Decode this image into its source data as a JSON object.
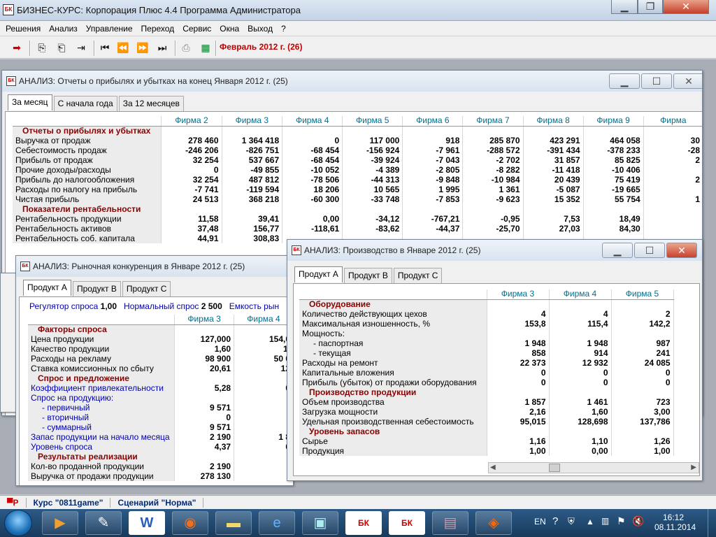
{
  "app": {
    "title": "БИЗНЕС-КУРС: Корпорация Плюс 4.4 Программа Администратора",
    "logo": "БК"
  },
  "menu": [
    "Решения",
    "Анализ",
    "Управление",
    "Переход",
    "Сервис",
    "Окна",
    "Выход",
    "?"
  ],
  "toolbar": {
    "period": "Февраль 2012 г. (26)"
  },
  "win1": {
    "title": "АНАЛИЗ: Отчеты о прибылях и убытках на конец Января 2012 г. (25)",
    "tabs": [
      "За месяц",
      "С начала года",
      "За 12 месяцев"
    ],
    "headers": [
      "Фирма 2",
      "Фирма 3",
      "Фирма 4",
      "Фирма 5",
      "Фирма 6",
      "Фирма 7",
      "Фирма 8",
      "Фирма 9",
      "Фирма"
    ],
    "rows": [
      {
        "label": "Отчеты о прибылях и убытках",
        "section": true,
        "values": [
          "",
          "",
          "",
          "",
          "",
          "",
          "",
          "",
          ""
        ]
      },
      {
        "label": "Выручка от продаж",
        "values": [
          "278 460",
          "1 364 418",
          "0",
          "117 000",
          "918",
          "285 870",
          "423 291",
          "464 058",
          "30"
        ]
      },
      {
        "label": "Себестоимость продаж",
        "values": [
          "-246 206",
          "-826 751",
          "-68 454",
          "-156 924",
          "-7 961",
          "-288 572",
          "-391 434",
          "-378 233",
          "-28"
        ]
      },
      {
        "label": "Прибыль от продаж",
        "values": [
          "32 254",
          "537 667",
          "-68 454",
          "-39 924",
          "-7 043",
          "-2 702",
          "31 857",
          "85 825",
          "2"
        ]
      },
      {
        "label": "Прочие доходы/расходы",
        "values": [
          "0",
          "-49 855",
          "-10 052",
          "-4 389",
          "-2 805",
          "-8 282",
          "-11 418",
          "-10 406",
          ""
        ]
      },
      {
        "label": "Прибыль до налогообложения",
        "values": [
          "32 254",
          "487 812",
          "-78 506",
          "-44 313",
          "-9 848",
          "-10 984",
          "20 439",
          "75 419",
          "2"
        ]
      },
      {
        "label": "Расходы по налогу на прибыль",
        "values": [
          "-7 741",
          "-119 594",
          "18 206",
          "10 565",
          "1 995",
          "1 361",
          "-5 087",
          "-19 665",
          ""
        ]
      },
      {
        "label": "Чистая прибыль",
        "values": [
          "24 513",
          "368 218",
          "-60 300",
          "-33 748",
          "-7 853",
          "-9 623",
          "15 352",
          "55 754",
          "1"
        ]
      },
      {
        "label": "Показатели рентабельности",
        "section": true,
        "values": [
          "",
          "",
          "",
          "",
          "",
          "",
          "",
          "",
          ""
        ]
      },
      {
        "label": "Рентабельность продукции",
        "values": [
          "11,58",
          "39,41",
          "0,00",
          "-34,12",
          "-767,21",
          "-0,95",
          "7,53",
          "18,49",
          ""
        ]
      },
      {
        "label": "Рентабельность активов",
        "values": [
          "37,48",
          "156,77",
          "-118,61",
          "-83,62",
          "-44,37",
          "-25,70",
          "27,03",
          "84,30",
          ""
        ]
      },
      {
        "label": "Рентабельность соб. капитала",
        "values": [
          "44,91",
          "308,83",
          "",
          "",
          "",
          "",
          "",
          "",
          ""
        ]
      }
    ]
  },
  "win2": {
    "title": "АНАЛИЗ: Рыночная конкуренция в Январе 2012 г. (25)",
    "tabs": [
      "Продукт А",
      "Продукт В",
      "Продукт С"
    ],
    "info": {
      "reg_label": "Регулятор спроса",
      "reg_value": "1,00",
      "norm_label": "Нормальный спрос",
      "norm_value": "2 500",
      "cap_label": "Емкость рын"
    },
    "headers": [
      "Фирма 3",
      "Фирма 4"
    ],
    "rows": [
      {
        "label": "Факторы спроса",
        "section": true,
        "values": [
          "",
          ""
        ]
      },
      {
        "label": "Цена продукции",
        "values": [
          "127,000",
          "154,0"
        ]
      },
      {
        "label": "Качество продукции",
        "values": [
          "1,60",
          "1,"
        ]
      },
      {
        "label": "Расходы на рекламу",
        "values": [
          "98 900",
          "50 0"
        ]
      },
      {
        "label": "Ставка комиссионных по сбыту",
        "values": [
          "20,61",
          "12"
        ]
      },
      {
        "label": "Спрос и предложение",
        "section": true,
        "values": [
          "",
          ""
        ]
      },
      {
        "label": "Коэффициент привлекательности",
        "blue": true,
        "values": [
          "5,28",
          "0"
        ]
      },
      {
        "label": "Спрос на продукцию:",
        "blue": true,
        "values": [
          "",
          ""
        ]
      },
      {
        "label": "- первичный",
        "blue": true,
        "indent": true,
        "values": [
          "9 571",
          ""
        ]
      },
      {
        "label": "- вторичный",
        "blue": true,
        "indent": true,
        "values": [
          "0",
          ""
        ]
      },
      {
        "label": "- суммарный",
        "blue": true,
        "indent": true,
        "values": [
          "9 571",
          ""
        ]
      },
      {
        "label": "Запас продукции на начало месяца",
        "blue": true,
        "values": [
          "2 190",
          "1 8"
        ]
      },
      {
        "label": "Уровень спроса",
        "blue": true,
        "values": [
          "4,37",
          "0"
        ]
      },
      {
        "label": "Результаты реализации",
        "section": true,
        "values": [
          "",
          ""
        ]
      },
      {
        "label": "Кол-во проданной продукции",
        "values": [
          "2 190",
          ""
        ]
      },
      {
        "label": "Выручка от продажи продукции",
        "values": [
          "278 130",
          ""
        ]
      }
    ]
  },
  "win3": {
    "title": "АНАЛИЗ: Производство в Январе 2012 г. (25)",
    "tabs": [
      "Продукт А",
      "Продукт В",
      "Продукт С"
    ],
    "headers": [
      "Фирма 3",
      "Фирма 4",
      "Фирма 5"
    ],
    "rows": [
      {
        "label": "Оборудование",
        "section": true,
        "values": [
          "",
          "",
          ""
        ]
      },
      {
        "label": "Количество действующих цехов",
        "values": [
          "4",
          "4",
          "2"
        ]
      },
      {
        "label": "Максимальная изношенность, %",
        "values": [
          "153,8",
          "115,4",
          "142,2"
        ]
      },
      {
        "label": "Мощность:",
        "values": [
          "",
          "",
          ""
        ]
      },
      {
        "label": "- паспортная",
        "indent": true,
        "values": [
          "1 948",
          "1 948",
          "987"
        ]
      },
      {
        "label": "- текущая",
        "indent": true,
        "values": [
          "858",
          "914",
          "241"
        ]
      },
      {
        "label": "Расходы на ремонт",
        "values": [
          "22 373",
          "12 932",
          "24 085"
        ]
      },
      {
        "label": "Капитальные вложения",
        "values": [
          "0",
          "0",
          "0"
        ]
      },
      {
        "label": "Прибыль (убыток) от продажи оборудования",
        "values": [
          "0",
          "0",
          "0"
        ]
      },
      {
        "label": "Производство продукции",
        "section": true,
        "values": [
          "",
          "",
          ""
        ]
      },
      {
        "label": "Объем производства",
        "values": [
          "1 857",
          "1 461",
          "723"
        ]
      },
      {
        "label": "Загрузка мощности",
        "values": [
          "2,16",
          "1,60",
          "3,00"
        ]
      },
      {
        "label": "Удельная производственная себестоимость",
        "values": [
          "95,015",
          "128,698",
          "137,786"
        ]
      },
      {
        "label": "Уровень запасов",
        "section": true,
        "values": [
          "",
          "",
          ""
        ]
      },
      {
        "label": "Сырье",
        "values": [
          "1,16",
          "1,10",
          "1,26"
        ]
      },
      {
        "label": "Продукция",
        "values": [
          "1,00",
          "0,00",
          "1,00"
        ]
      }
    ]
  },
  "status": {
    "course": "Курс \"0811game\"",
    "scenario": "Сценарий \"Норма\""
  },
  "taskbar": {
    "lang": "EN",
    "time": "16:12",
    "date": "08.11.2014"
  }
}
